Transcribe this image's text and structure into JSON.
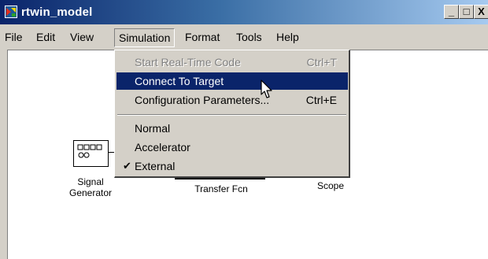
{
  "window": {
    "title": "rtwin_model",
    "minimize_label": "_",
    "maximize_label": "□",
    "close_label": "X"
  },
  "menubar": {
    "items": [
      {
        "label": "File"
      },
      {
        "label": "Edit"
      },
      {
        "label": "View"
      },
      {
        "label": "Simulation"
      },
      {
        "label": "Format"
      },
      {
        "label": "Tools"
      },
      {
        "label": "Help"
      }
    ]
  },
  "simulation_menu": {
    "items": [
      {
        "label": "Start Real-Time Code",
        "shortcut": "Ctrl+T",
        "state": "disabled"
      },
      {
        "label": "Connect To Target",
        "shortcut": "",
        "state": "highlighted"
      },
      {
        "label": "Configuration Parameters...",
        "shortcut": "Ctrl+E",
        "state": "normal"
      },
      {
        "label": "Normal",
        "shortcut": "",
        "state": "normal"
      },
      {
        "label": "Accelerator",
        "shortcut": "",
        "state": "normal"
      },
      {
        "label": "External",
        "shortcut": "",
        "state": "checked",
        "check": "✔"
      }
    ]
  },
  "diagram": {
    "signal_generator_label_1": "Signal",
    "signal_generator_label_2": "Generator",
    "transfer_fcn_label": "Transfer Fcn",
    "scope_label": "Scope"
  },
  "colors": {
    "highlight": "#0a246a",
    "face": "#d4d0c8"
  }
}
